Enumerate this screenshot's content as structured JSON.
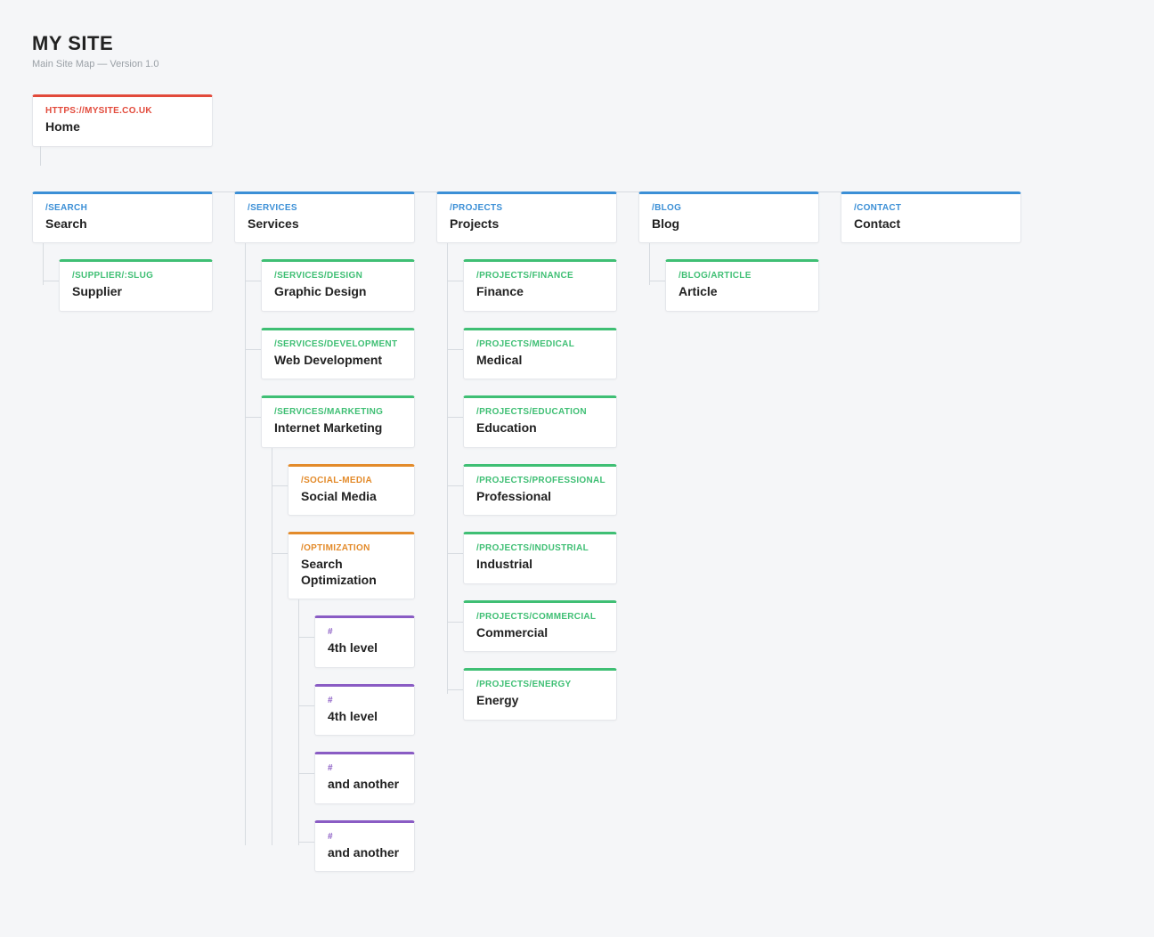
{
  "header": {
    "title": "MY SITE",
    "subtitle": "Main Site Map — Version 1.0"
  },
  "root": {
    "path": "HTTPS://MYSITE.CO.UK",
    "label": "Home"
  },
  "columns": [
    {
      "path": "/SEARCH",
      "label": "Search",
      "children": [
        {
          "path": "/SUPPLIER/:SLUG",
          "label": "Supplier"
        }
      ]
    },
    {
      "path": "/SERVICES",
      "label": "Services",
      "children": [
        {
          "path": "/SERVICES/DESIGN",
          "label": "Graphic Design"
        },
        {
          "path": "/SERVICES/DEVELOPMENT",
          "label": "Web Development"
        },
        {
          "path": "/SERVICES/MARKETING",
          "label": "Internet Marketing",
          "children": [
            {
              "path": "/SOCIAL-MEDIA",
              "label": "Social Media"
            },
            {
              "path": "/OPTIMIZATION",
              "label": "Search Optimization",
              "children": [
                {
                  "path": "#",
                  "label": "4th level"
                },
                {
                  "path": "#",
                  "label": "4th level"
                },
                {
                  "path": "#",
                  "label": "and another"
                },
                {
                  "path": "#",
                  "label": "and another"
                }
              ]
            }
          ]
        }
      ]
    },
    {
      "path": "/PROJECTS",
      "label": "Projects",
      "children": [
        {
          "path": "/PROJECTS/FINANCE",
          "label": "Finance"
        },
        {
          "path": "/PROJECTS/MEDICAL",
          "label": "Medical"
        },
        {
          "path": "/PROJECTS/EDUCATION",
          "label": "Education"
        },
        {
          "path": "/PROJECTS/PROFESSIONAL",
          "label": "Professional"
        },
        {
          "path": "/PROJECTS/INDUSTRIAL",
          "label": "Industrial"
        },
        {
          "path": "/PROJECTS/COMMERCIAL",
          "label": "Commercial"
        },
        {
          "path": "/PROJECTS/ENERGY",
          "label": "Energy"
        }
      ]
    },
    {
      "path": "/BLOG",
      "label": "Blog",
      "children": [
        {
          "path": "/BLOG/ARTICLE",
          "label": "Article"
        }
      ]
    },
    {
      "path": "/CONTACT",
      "label": "Contact",
      "children": []
    }
  ],
  "colors": {
    "root": "#e24a3b",
    "level1": "#3b8fd6",
    "level2": "#3fbf74",
    "level3": "#e38b2b",
    "level4": "#8a5cc4"
  }
}
